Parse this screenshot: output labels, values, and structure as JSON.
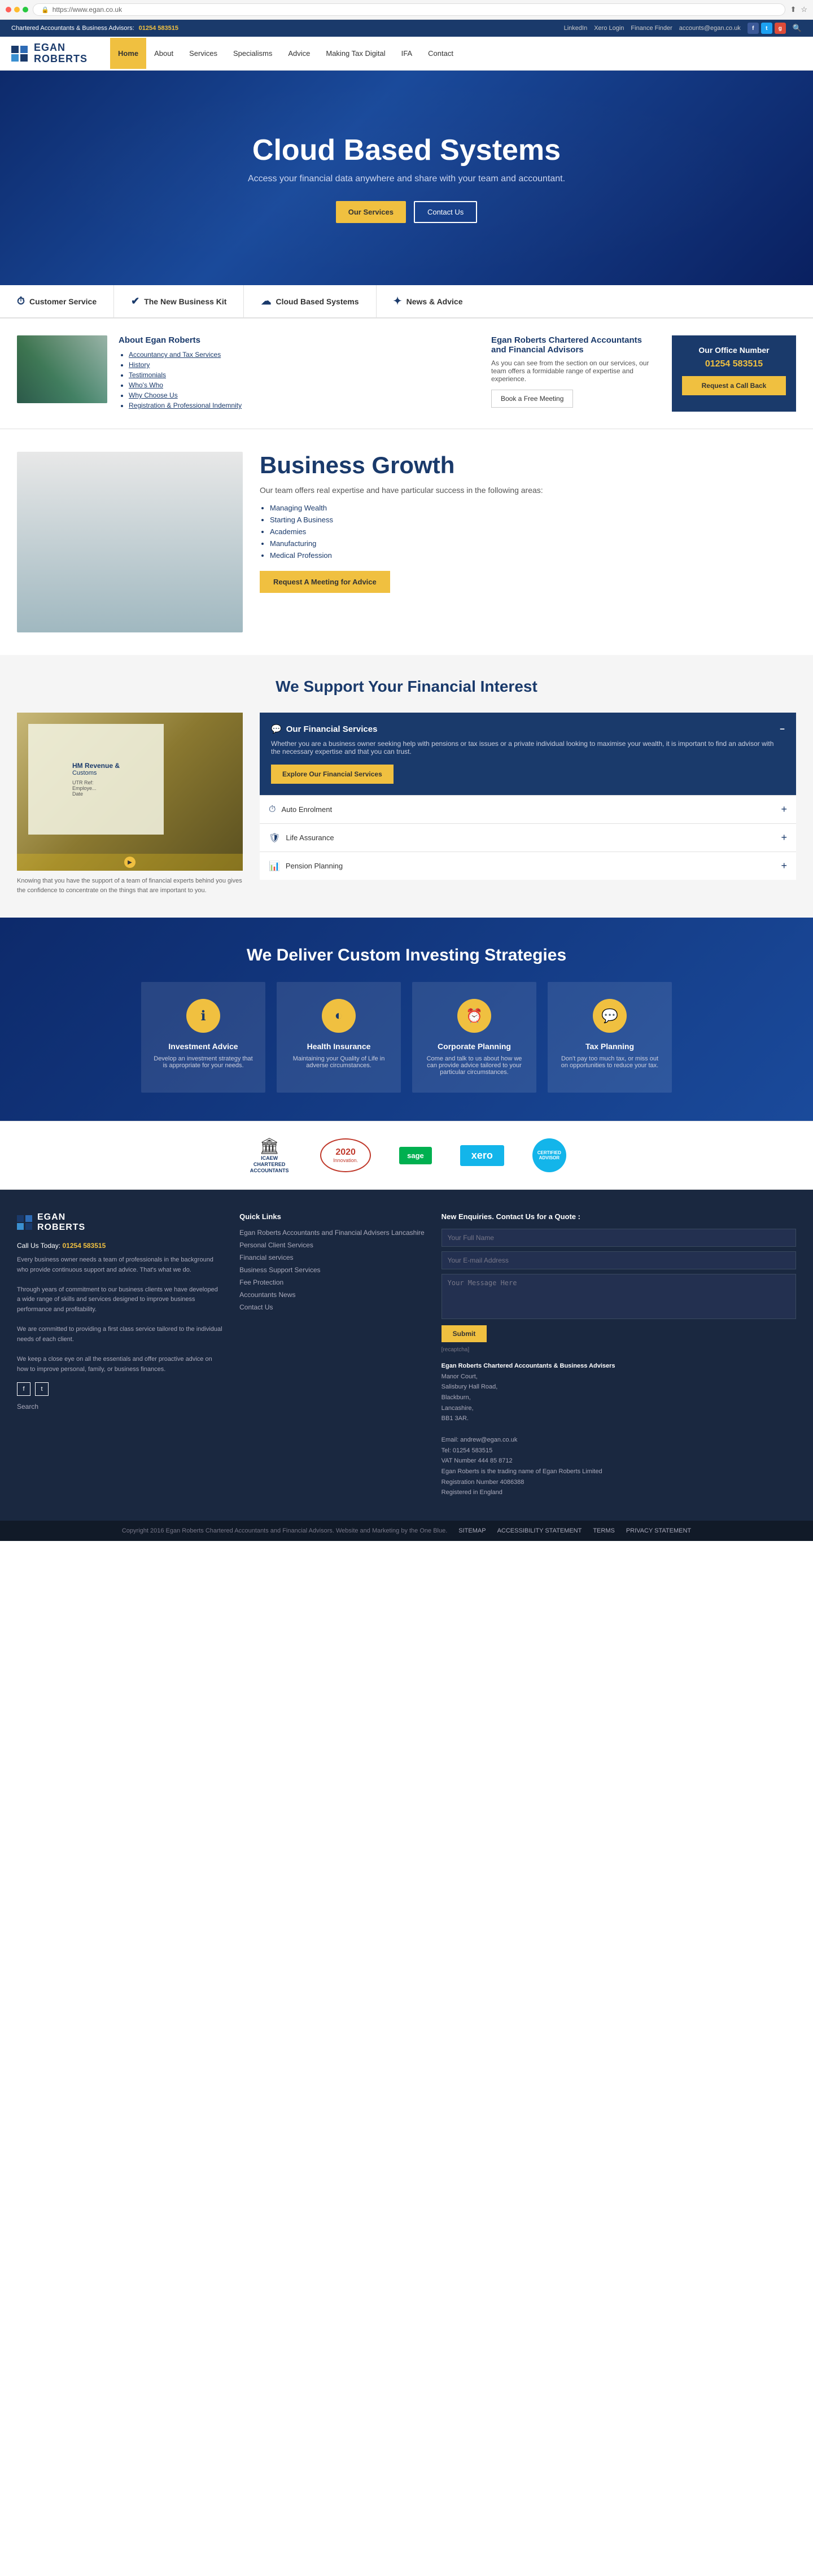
{
  "browser": {
    "url": "https://www.egan.co.uk",
    "url_display": "https://www.egan.co.uk"
  },
  "topbar": {
    "description": "Chartered Accountants & Business Advisors:",
    "phone": "01254 583515",
    "links": [
      "LinkedIn",
      "Xero Login",
      "Finance Finder",
      "accounts@egan.co.uk"
    ],
    "social": [
      "f",
      "t",
      "g+"
    ]
  },
  "nav": {
    "logo_name": "EGAN\nROBERTS",
    "links": [
      "Home",
      "About",
      "Services",
      "Specialisms",
      "Advice",
      "Making Tax Digital",
      "IFA",
      "Contact"
    ]
  },
  "hero": {
    "title": "Cloud Based Systems",
    "subtitle": "Access your financial data anywhere and share with your team and accountant.",
    "btn_services": "Our Services",
    "btn_contact": "Contact Us"
  },
  "service_tabs": [
    {
      "icon": "⏱",
      "label": "Customer Service"
    },
    {
      "icon": "✓",
      "label": "The New Business Kit"
    },
    {
      "icon": "☁",
      "label": "Cloud Based Systems"
    },
    {
      "icon": "✦",
      "label": "News & Advice"
    }
  ],
  "about": {
    "heading": "About Egan Roberts",
    "links": [
      "Accountancy and Tax Services",
      "History",
      "Testimonials",
      "Who's Who",
      "Why Choose Us",
      "Registration & Professional Indemnity"
    ],
    "right_heading": "Egan Roberts Chartered Accountants and Financial Advisors",
    "right_text": "As you can see from the section on our services, our team offers a formidable range of expertise and experience.",
    "btn_book": "Book a Free Meeting",
    "office_heading": "Our Office Number",
    "office_phone": "01254 583515",
    "btn_callback": "Request a Call Back"
  },
  "business_growth": {
    "heading": "Business Growth",
    "intro": "Our team offers real expertise and have particular success in the following areas:",
    "list": [
      "Managing Wealth",
      "Starting A Business",
      "Academies",
      "Manufacturing",
      "Medical Profession"
    ],
    "btn_meeting": "Request A Meeting for Advice"
  },
  "financial": {
    "section_heading": "We Support Your Financial Interest",
    "img_caption": "Knowing that you have the support of a team of financial experts behind you gives the confidence to concentrate on the things that are important to you.",
    "box_heading": "Our Financial Services",
    "box_text": "Whether you are a business owner seeking help with pensions or tax issues or a private individual looking to maximise your wealth, it is important to find an advisor with the necessary expertise and that you can trust.",
    "btn_explore": "Explore Our Financial Services",
    "accordion": [
      {
        "icon": "⏱",
        "label": "Auto Enrolment"
      },
      {
        "icon": "🛡",
        "label": "Life Assurance"
      },
      {
        "icon": "📊",
        "label": "Pension Planning"
      }
    ]
  },
  "investing": {
    "heading": "We Deliver Custom Investing Strategies",
    "cards": [
      {
        "icon": "ℹ",
        "title": "Investment Advice",
        "desc": "Develop an investment strategy that is appropriate for your needs."
      },
      {
        "icon": "◐",
        "title": "Health Insurance",
        "desc": "Maintaining your Quality of Life in adverse circumstances."
      },
      {
        "icon": "⏰",
        "title": "Corporate Planning",
        "desc": "Come and talk to us about how we can provide advice tailored to your particular circumstances."
      },
      {
        "icon": "💬",
        "title": "Tax Planning",
        "desc": "Don't pay too much tax, or miss out on opportunities to reduce your tax."
      }
    ]
  },
  "partners": [
    {
      "name": "ICAEW Chartered Accountants"
    },
    {
      "name": "2020 Innovation"
    },
    {
      "name": "Sage"
    },
    {
      "name": "Xero"
    },
    {
      "name": "Certified Advisor"
    }
  ],
  "footer": {
    "logo_name": "EGAN\nROBERTS",
    "call_label": "Call Us Today:",
    "phone": "01254 583515",
    "description": "Every business owner needs a team of professionals in the background who provide continuous support and advice. That's what we do.\n\nThrough years of commitment to our business clients we have developed a wide range of skills and services designed to improve business performance and profitability.\n\nWe are committed to providing a first class service tailored to the individual needs of each client.\n\nWe keep a close eye on all the essentials and offer proactive advice on how to improve personal, family, or business finances.",
    "quick_links_heading": "Quick Links",
    "quick_links": [
      "Egan Roberts Accountants and Financial Advisers Lancashire",
      "Personal Client Services",
      "Financial services",
      "Business Support Services",
      "Fee Protection",
      "Accountants News",
      "Contact Us"
    ],
    "contact_heading": "New Enquiries. Contact Us for a Quote :",
    "form": {
      "name_placeholder": "Your Full Name",
      "email_placeholder": "Your E-mail Address",
      "message_placeholder": "Your Message Here",
      "submit_label": "Submit",
      "recaptcha": "[recaptcha]"
    },
    "address_heading": "Egan Roberts Chartered Accountants & Business Advisers",
    "address_lines": [
      "Manor Court,",
      "Salisbury Hall Road,",
      "Blackburn,",
      "Lancashire,",
      "BB1 3AR."
    ],
    "contact_details": [
      "Email: andrew@egan.co.uk",
      "Tel: 01254 583515",
      "VAT Number 444 85 8712",
      "Egan Roberts is the trading name of Egan Roberts Limited",
      "Registration Number 4086388",
      "Registered in England"
    ]
  },
  "footer_bottom": {
    "copyright": "Copyright 2016 Egan Roberts Chartered Accountants and Financial Advisors. Website and Marketing by the One Blue.",
    "links": [
      "SITEMAP",
      "ACCESSIBILITY STATEMENT",
      "TERMS",
      "PRIVACY STATEMENT"
    ]
  }
}
